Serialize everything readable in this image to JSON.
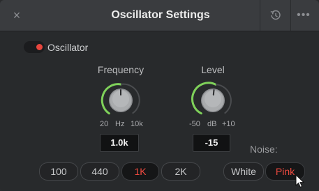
{
  "window": {
    "title": "Oscillator Settings",
    "close_glyph": "×",
    "more_glyph": "•••"
  },
  "oscillator": {
    "label": "Oscillator",
    "enabled": true,
    "toggle_color": "#e8463e"
  },
  "frequency": {
    "label": "Frequency",
    "scale_min": "20",
    "scale_unit": "Hz",
    "scale_max": "10k",
    "value": "1.0k"
  },
  "level": {
    "label": "Level",
    "scale_min": "-50",
    "scale_unit": "dB",
    "scale_max": "+10",
    "value": "-15"
  },
  "presets": [
    {
      "label": "100",
      "active": false
    },
    {
      "label": "440",
      "active": false
    },
    {
      "label": "1K",
      "active": true
    },
    {
      "label": "2K",
      "active": false
    }
  ],
  "noise": {
    "label": "Noise:",
    "options": [
      {
        "label": "White",
        "active": false
      },
      {
        "label": "Pink",
        "active": true
      }
    ]
  },
  "colors": {
    "accent_red": "#ee4a3f",
    "knob_arc_green": "#7fd15a"
  },
  "icons": {
    "close": "close-icon",
    "reset": "reset-icon",
    "more": "more-icon"
  }
}
